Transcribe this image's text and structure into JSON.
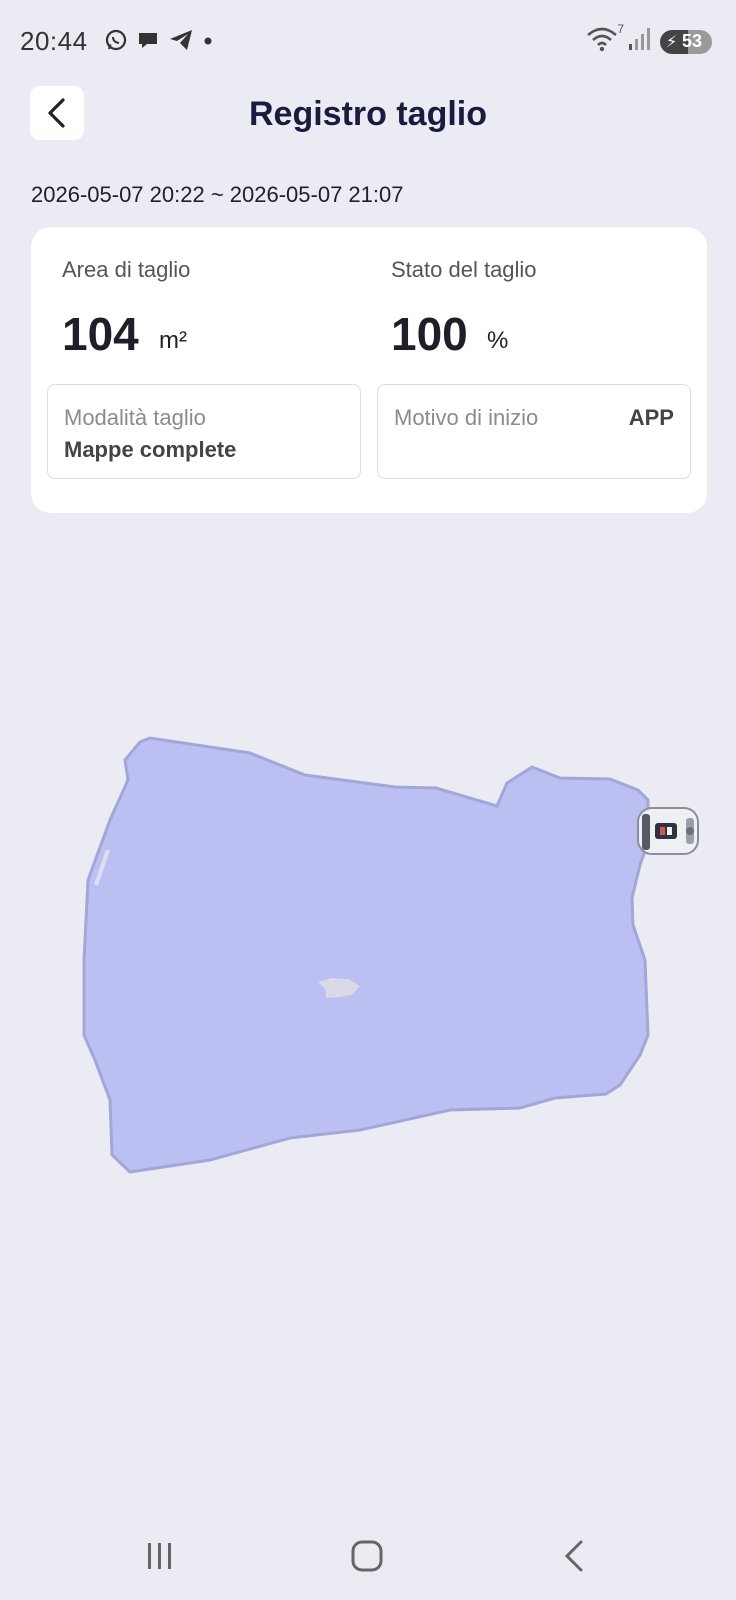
{
  "status_bar": {
    "time": "20:44",
    "left_icons": [
      "whatsapp-icon",
      "message-icon",
      "telegram-icon",
      "dot-icon"
    ],
    "right_icons": [
      "wifi-icon",
      "signal-icon",
      "battery-icon"
    ],
    "battery_level": "53",
    "wifi_badge": "7"
  },
  "header": {
    "title": "Registro taglio",
    "back_icon": "chevron-left-icon"
  },
  "session": {
    "date_range": "2026-05-07 20:22 ~ 2026-05-07 21:07"
  },
  "summary": {
    "area_label": "Area di taglio",
    "area_value": "104",
    "area_unit": "m²",
    "status_label": "Stato del taglio",
    "status_value": "100",
    "status_unit": "%",
    "mode_label": "Modalità taglio",
    "mode_value": "Mappe complete",
    "start_reason_label": "Motivo di inizio",
    "start_reason_value": "APP"
  },
  "map": {
    "lawn_color": "#bbbff2",
    "lawn_border_color": "#a3a6d8",
    "obstacle_color": "#d9dae6",
    "mower_icon": "robot-mower-icon"
  },
  "nav_bar": {
    "recents_icon": "recents-icon",
    "home_icon": "home-icon",
    "back_icon": "back-icon"
  }
}
